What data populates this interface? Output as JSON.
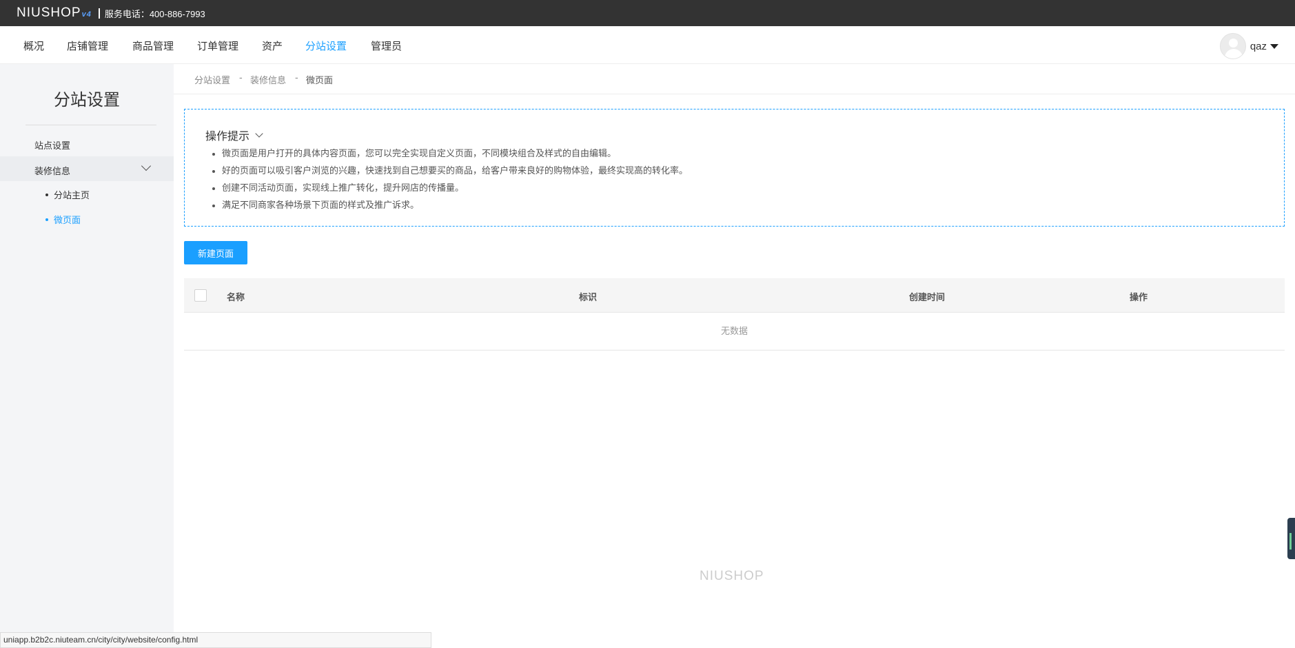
{
  "topbar": {
    "logo_text": "NIUSHOP",
    "logo_version": "v4",
    "phone": "服务电话：400-886-7993"
  },
  "nav": {
    "items": [
      {
        "label": "概况",
        "active": false
      },
      {
        "label": "店铺管理",
        "active": false
      },
      {
        "label": "商品管理",
        "active": false
      },
      {
        "label": "订单管理",
        "active": false
      },
      {
        "label": "资产",
        "active": false
      },
      {
        "label": "分站设置",
        "active": true
      },
      {
        "label": "管理员",
        "active": false
      }
    ],
    "user": {
      "name": "qaz",
      "avatar_icon": "user-avatar-icon"
    }
  },
  "sidebar": {
    "title": "分站设置",
    "items": [
      {
        "label": "站点设置"
      },
      {
        "label": "装修信息",
        "expanded": true,
        "children": [
          {
            "label": "分站主页",
            "active": false
          },
          {
            "label": "微页面",
            "active": true
          }
        ]
      }
    ]
  },
  "breadcrumb": {
    "items": [
      "分站设置",
      "装修信息",
      "微页面"
    ],
    "separator": "-"
  },
  "tips": {
    "title": "操作提示",
    "lines": [
      "微页面是用户打开的具体内容页面，您可以完全实现自定义页面，不同模块组合及样式的自由编辑。",
      "好的页面可以吸引客户浏览的兴趣，快速找到自己想要买的商品，给客户带来良好的购物体验，最终实现高的转化率。",
      "创建不同活动页面，实现线上推广转化，提升网店的传播量。",
      "满足不同商家各种场景下页面的样式及推广诉求。"
    ]
  },
  "actions": {
    "new_page": "新建页面"
  },
  "table": {
    "columns": [
      "名称",
      "标识",
      "创建时间",
      "操作"
    ],
    "empty_text": "无数据"
  },
  "footer": {
    "logo_text": "NIUSHOP"
  },
  "statusbar": {
    "url": "uniapp.b2b2c.niuteam.cn/city/city/website/config.html"
  },
  "colors": {
    "accent": "#1a9fff",
    "topbar": "#333333",
    "sidebar_bg": "#f4f5f7"
  }
}
